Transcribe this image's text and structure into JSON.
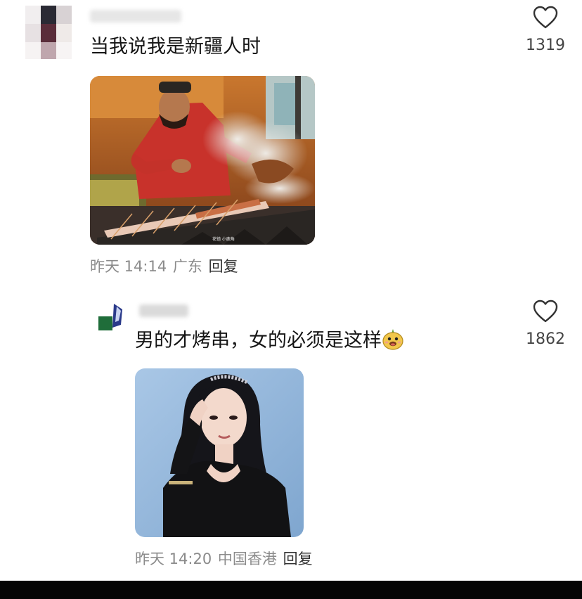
{
  "comments": [
    {
      "text": "当我说我是新疆人时",
      "time": "昨天 14:14",
      "location": "广东",
      "reply_label": "回复",
      "likes": "1319"
    },
    {
      "text": "男的才烤串，女的必须是这样",
      "time": "昨天 14:20",
      "location": "中国香港",
      "reply_label": "回复",
      "likes": "1862"
    }
  ],
  "icons": {
    "like": "heart-outline-icon",
    "emoji": "smiling-face-emoji"
  },
  "photo1": {
    "caption_text": "花镇 小鹿角"
  }
}
